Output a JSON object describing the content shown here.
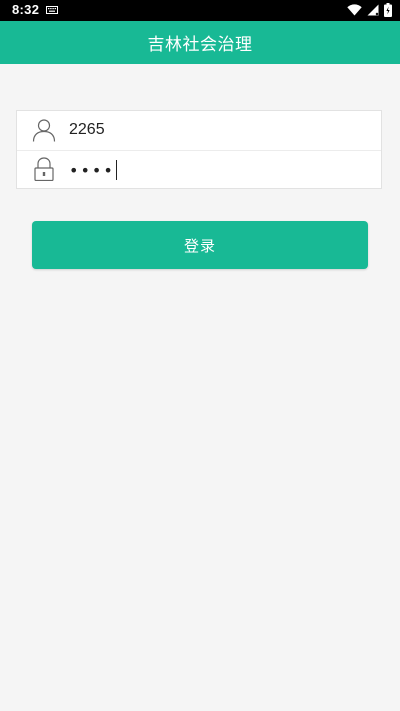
{
  "status_bar": {
    "time": "8:32",
    "icons": [
      "keyboard-icon",
      "wifi-icon",
      "signal-icon",
      "battery-icon"
    ]
  },
  "app_bar": {
    "title": "吉林社会治理"
  },
  "login_form": {
    "username": {
      "value": "2265",
      "icon": "user-icon"
    },
    "password": {
      "masked_value": "••••",
      "icon": "lock-icon"
    },
    "submit_label": "登录"
  },
  "colors": {
    "primary": "#18b995",
    "background": "#f5f5f5",
    "status_bar": "#000000"
  }
}
